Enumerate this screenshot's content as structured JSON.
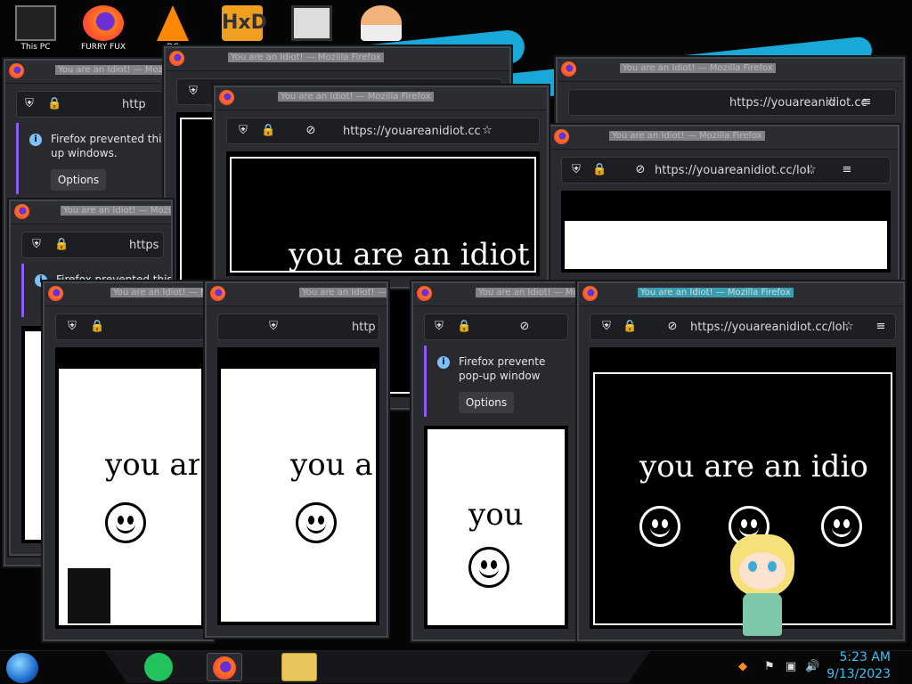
{
  "desktop": {
    "icons": [
      {
        "name": "this-pc-icon",
        "label": "This PC"
      },
      {
        "name": "firefox-desktop-icon",
        "label": "FURRY FUX"
      },
      {
        "name": "vlc-icon",
        "label": "DC"
      },
      {
        "name": "hxd-icon",
        "label": ""
      },
      {
        "name": "app-icon",
        "label": ""
      },
      {
        "name": "user-icon",
        "label": ""
      }
    ]
  },
  "windows": {
    "title": "You are an Idiot! — Mozilla Firefox",
    "url_short": "https://youareanidiot.cc",
    "url_long": "https://youareanidiot.cc/lol.",
    "url_trunc": "http",
    "url_trunc2": "https",
    "notice_text": "Firefox prevented this site from opening pop-up windows.",
    "notice_text_a": "Firefox prevented this s",
    "notice_text_b": "up windows.",
    "notice_text_c": "Firefox prevented this si",
    "notice_text_d": "Firefox prevente",
    "notice_text_e": "pop-up window",
    "options_label": "Options",
    "options_trunc": "ons",
    "phrase": "you are an idiot",
    "phrase_a": "you are",
    "phrase_b": "you a",
    "phrase_c": "you",
    "phrase_d": "you are an idio"
  },
  "taskbar": {
    "time": "5:23 AM",
    "date": "9/13/2023",
    "accent": "#3cc0f0"
  }
}
